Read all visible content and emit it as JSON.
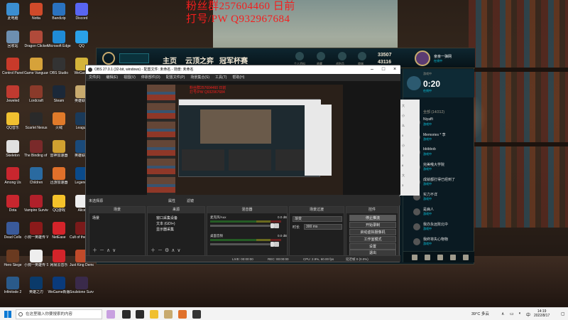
{
  "overlay": {
    "line1": "粉丝群257604460 日前",
    "line2": "打号/PW Q932967684"
  },
  "desktop_icons": [
    {
      "label": "此电脑",
      "color": "#3b8ed0"
    },
    {
      "label": "Notta",
      "color": "#d04a2a"
    },
    {
      "label": "Bandizip",
      "color": "#2a72c0"
    },
    {
      "label": "Discord",
      "color": "#5865f2"
    },
    {
      "label": "回收站",
      "color": "#6d8fb0"
    },
    {
      "label": "Dragon Clicker",
      "color": "#b04a3a"
    },
    {
      "label": "Microsoft Edge",
      "color": "#1f8bd6"
    },
    {
      "label": "QQ",
      "color": "#2aa1e8"
    },
    {
      "label": "Control Panel",
      "color": "#c83a2a"
    },
    {
      "label": "Game Vanguard",
      "color": "#d6a23a"
    },
    {
      "label": "OBS Studio",
      "color": "#333333"
    },
    {
      "label": "WeGame",
      "color": "#d4b43a"
    },
    {
      "label": "Jeweled",
      "color": "#c03a30"
    },
    {
      "label": "Lordcraft",
      "color": "#8a3a2a"
    },
    {
      "label": "Steam",
      "color": "#1b2838"
    },
    {
      "label": "英雄联盟",
      "color": "#c8aa6e"
    },
    {
      "label": "QQ音乐",
      "color": "#f0c030"
    },
    {
      "label": "Scarlet Nexus",
      "color": "#2a2a2a"
    },
    {
      "label": "火绒",
      "color": "#e07a2a"
    },
    {
      "label": "League",
      "color": "#1a3a5a"
    },
    {
      "label": "Skeleton",
      "color": "#e0e0e0"
    },
    {
      "label": "The Binding of Isaac",
      "color": "#7a2a2a"
    },
    {
      "label": "雷神加速器",
      "color": "#d0a030"
    },
    {
      "label": "英雄联盟",
      "color": "#1a4a7a"
    },
    {
      "label": "Among Us",
      "color": "#c8262e"
    },
    {
      "label": "Children",
      "color": "#2a6aa0"
    },
    {
      "label": "迅游加速器",
      "color": "#e0702a"
    },
    {
      "label": "Legends",
      "color": "#0a4a8a"
    },
    {
      "label": "Dota",
      "color": "#c8262e"
    },
    {
      "label": "Vampire Survivors",
      "color": "#b0202a"
    },
    {
      "label": "QQ游戏",
      "color": "#f5c22a"
    },
    {
      "label": "Alice",
      "color": "#eeeeee"
    },
    {
      "label": "Dead Cells",
      "color": "#3a5a9a"
    },
    {
      "label": "小狗一英雄传 Warm Snow",
      "color": "#8a1a1a"
    },
    {
      "label": "NetEase",
      "color": "#d4242a"
    },
    {
      "label": "Cult of the Lamb Demo",
      "color": "#7a1a1a"
    },
    {
      "label": "Hero Siege",
      "color": "#6a3a20"
    },
    {
      "label": "小狗一英雄传 Slay Jake",
      "color": "#eeeeee"
    },
    {
      "label": "网易云音乐",
      "color": "#d4242a"
    },
    {
      "label": "Just King Demo",
      "color": "#c04a2a"
    },
    {
      "label": "Infinitode 2",
      "color": "#2a5a8a"
    },
    {
      "label": "英雄之刃",
      "color": "#0a3a6a"
    },
    {
      "label": "WeGame新版",
      "color": "#0a3a7a"
    },
    {
      "label": "Soulstone Survivors",
      "color": "#3a2a4a"
    }
  ],
  "lol": {
    "nav": [
      "主页",
      "云顶之弈",
      "冠军杯赛"
    ],
    "icons": [
      "个人资料",
      "收藏",
      "战利品",
      "商城"
    ],
    "currency_rp": "33507",
    "currency_be": "43116",
    "username": "亲亲一弹网",
    "status": "在线中"
  },
  "friends": {
    "header": "游戏中",
    "timer": "0:20",
    "timer_status": "在线中",
    "group": "全部 (14/312)",
    "entries": [
      {
        "name": "Niyaffi",
        "status": "游戏中"
      },
      {
        "name": "Memories * 李",
        "status": "游戏中"
      },
      {
        "name": "bbibbob",
        "status": "游戏中"
      },
      {
        "name": "完美哦大学院",
        "status": "游戏中"
      },
      {
        "name": "成就都打得已经到了",
        "status": "游戏中"
      },
      {
        "name": "实力不详",
        "status": "游戏中"
      },
      {
        "name": "是病人",
        "status": "游戏中"
      },
      {
        "name": "我亦永远败北中",
        "status": "游戏中"
      },
      {
        "name": "我终将失心物物",
        "status": "游戏中"
      }
    ]
  },
  "white_strip": [
    "大",
    "小",
    "么",
    "0",
    "小",
    "3",
    "6",
    "大",
    "3"
  ],
  "obs": {
    "title": "OBS 27.0.1 (32-bit, windows) - 配置文件: 未命名 - 场景: 未命名",
    "menu": [
      "文件(F)",
      "编辑(E)",
      "视图(V)",
      "停靠部件(D)",
      "配置文件(P)",
      "场景集合(S)",
      "工具(T)",
      "帮助(H)"
    ],
    "scene_bar": {
      "label": "未选择源",
      "props": "属性",
      "filters": "滤镜"
    },
    "docks": {
      "scenes": {
        "title": "场景",
        "items": [
          "场景"
        ]
      },
      "sources": {
        "title": "来源",
        "items": [
          "窗口采集设备",
          "文本 (GDI+)",
          "显示器采集"
        ]
      },
      "mixer": {
        "title": "混音器",
        "rows": [
          {
            "label": "麦克风/Aux",
            "db": "0.0 dB"
          },
          {
            "label": "桌面音频",
            "db": "0.0 dB"
          }
        ]
      },
      "transitions": {
        "title": "场景过渡",
        "type": "渐变",
        "duration_label": "时长",
        "duration": "300 ms"
      },
      "controls": {
        "title": "控件",
        "buttons": [
          "停止推流",
          "开始录制",
          "启动虚拟摄像机",
          "工作室模式",
          "设置",
          "退出"
        ]
      }
    },
    "status": {
      "live": "LIVE: 00:00:00",
      "rec": "REC: 00:00:00",
      "cpu": "CPU: 2.9%, 60.00 fps",
      "drop": "延迟帧 0 (0.0%)"
    }
  },
  "taskbar": {
    "search_placeholder": "在这里输入你要搜索的内容",
    "weather": "39°C 多云",
    "time": "14:19",
    "date": "2022/8/17",
    "ime": "中"
  }
}
